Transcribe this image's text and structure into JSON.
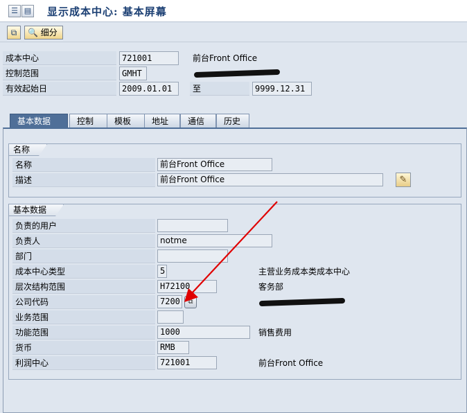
{
  "window": {
    "title": "显示成本中心: 基本屏幕"
  },
  "toolbar": {
    "detail_label": "细分"
  },
  "header": {
    "cost_center_label": "成本中心",
    "cost_center_value": "721001",
    "cost_center_desc": "前台Front Office",
    "controlling_area_label": "控制范围",
    "controlling_area_value": "GMHT",
    "valid_from_label": "有效起始日",
    "valid_from_value": "2009.01.01",
    "to_label": "至",
    "valid_to_value": "9999.12.31"
  },
  "tabs": [
    {
      "label": "基本数据",
      "active": true
    },
    {
      "label": "控制",
      "active": false
    },
    {
      "label": "模板",
      "active": false
    },
    {
      "label": "地址",
      "active": false
    },
    {
      "label": "通信",
      "active": false
    },
    {
      "label": "历史",
      "active": false
    }
  ],
  "names_group": {
    "title": "名称",
    "name_label": "名称",
    "name_value": "前台Front Office",
    "desc_label": "描述",
    "desc_value": "前台Front Office"
  },
  "basic_group": {
    "title": "基本数据",
    "rows": [
      {
        "label": "负责的用户",
        "value": "",
        "desc": ""
      },
      {
        "label": "负责人",
        "value": "notme",
        "desc": ""
      },
      {
        "label": "部门",
        "value": "",
        "desc": ""
      },
      {
        "label": "成本中心类型",
        "value": "5",
        "desc": "主营业务成本类成本中心"
      },
      {
        "label": "层次结构范围",
        "value": "H72100",
        "desc": "客务部"
      },
      {
        "label": "公司代码",
        "value": "7200",
        "desc": ""
      },
      {
        "label": "业务范围",
        "value": "",
        "desc": ""
      },
      {
        "label": "功能范围",
        "value": "1000",
        "desc": "销售费用"
      },
      {
        "label": "货币",
        "value": "RMB",
        "desc": ""
      },
      {
        "label": "利润中心",
        "value": "721001",
        "desc": "前台Front Office"
      }
    ]
  },
  "colors": {
    "background": "#dfe6ef",
    "active_tab": "#4f6f98",
    "title_text": "#1b3f73",
    "arrow": "#e00000"
  }
}
